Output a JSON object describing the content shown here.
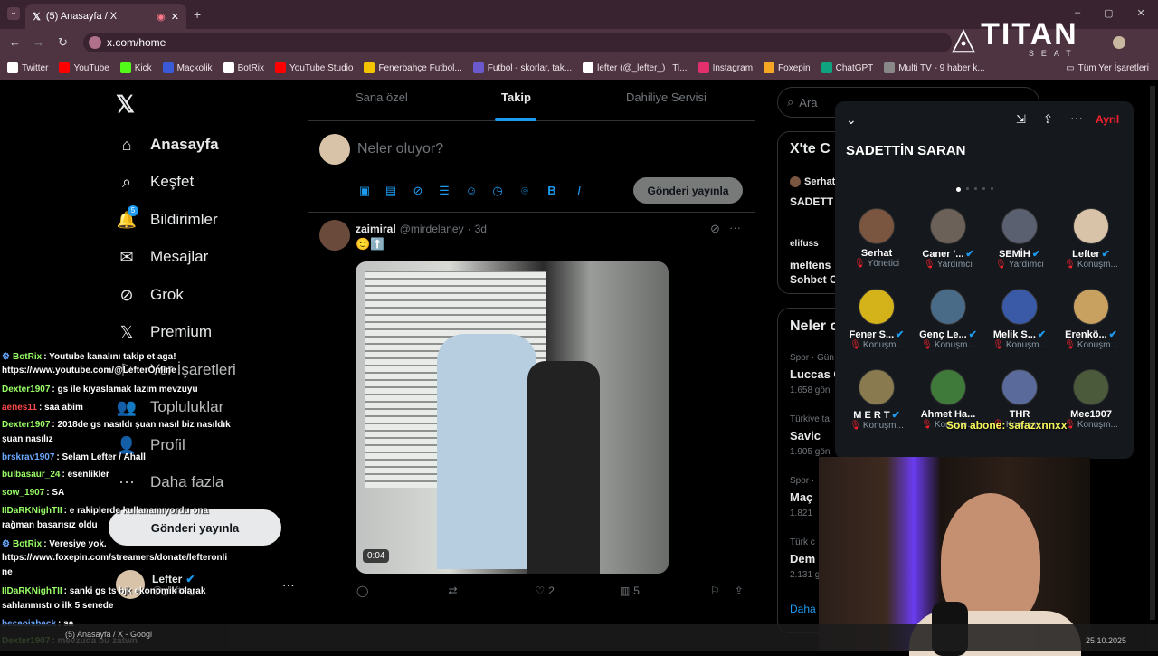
{
  "browser": {
    "tab_title": "(5) Anasayfa / X",
    "url": "x.com/home",
    "bookmarks": [
      "Twitter",
      "YouTube",
      "Kick",
      "Maçkolik",
      "BotRix",
      "YouTube Studio",
      "Fenerbahçe Futbol...",
      "Futbol - skorlar, tak...",
      "lefter (@_lefter_) | Ti...",
      "Instagram",
      "Foxepin",
      "ChatGPT",
      "Multi TV - 9 haber k..."
    ],
    "all_bookmarks": "Tüm Yer İşaretleri"
  },
  "overlay": {
    "brand": "TITAN",
    "brand_sub": "SEAT",
    "last_sub": "Son abone: safazxnnxx"
  },
  "sidebar": {
    "items": [
      "Anasayfa",
      "Keşfet",
      "Bildirimler",
      "Mesajlar",
      "Grok",
      "Premium",
      "Yer İşaretleri",
      "Topluluklar",
      "Profil",
      "Daha fazla"
    ],
    "notif_count": "5",
    "post_button": "Gönderi yayınla",
    "user_name": "Lefter",
    "user_handle": "@_lefter_"
  },
  "feed": {
    "tabs": [
      "Sana özel",
      "Takip",
      "Dahiliye Servisi"
    ],
    "compose_placeholder": "Neler oluyor?",
    "post_button": "Gönderi yayınla",
    "post": {
      "name": "zaimiral",
      "handle": "@mirdelaney",
      "time": "3d",
      "text": "🙂⬆️",
      "duration": "0:04",
      "likes": "2",
      "views": "5"
    }
  },
  "right": {
    "search": "Ara",
    "trends_title": "X'te C",
    "trend_user": "Serhat",
    "trend_text": "SADETT",
    "item2": "elifuss",
    "item2b": "meltens",
    "item2c": "Sohbet C",
    "happen_title": "Neler o",
    "trends": [
      {
        "cat": "Spor · Gün",
        "name": "Luccas C",
        "count": "1.658 gön"
      },
      {
        "cat": "Türkiye ta",
        "name": "Savic",
        "count": "1.905 gön"
      },
      {
        "cat": "Spor ·",
        "name": "Maç",
        "count": "1.821"
      },
      {
        "cat": "Türk c",
        "name": "Dem",
        "count": "2.131 g"
      }
    ],
    "more": "Daha"
  },
  "spaces": {
    "title": "SADETTİN SARAN",
    "leave": "Ayrıl",
    "people": [
      {
        "name": "Serhat",
        "role": "Yönetici",
        "verified": false,
        "color": "#7a5540"
      },
      {
        "name": "Caner '...",
        "role": "Yardımcı",
        "verified": true,
        "color": "#6b6158"
      },
      {
        "name": "SEMİH",
        "role": "Yardımcı",
        "verified": true,
        "color": "#5a6070"
      },
      {
        "name": "Lefter",
        "role": "Konuşm...",
        "verified": true,
        "color": "#d8c2a8"
      },
      {
        "name": "Fener S...",
        "role": "Konuşm...",
        "verified": true,
        "color": "#d4b21a"
      },
      {
        "name": "Genç Le...",
        "role": "Konuşm...",
        "verified": true,
        "color": "#4a6b88"
      },
      {
        "name": "Melik S...",
        "role": "Konuşm...",
        "verified": true,
        "color": "#3a5aa8"
      },
      {
        "name": "Erenkö...",
        "role": "Konuşm...",
        "verified": true,
        "color": "#c8a060"
      },
      {
        "name": "M E R T",
        "role": "Konuşm...",
        "verified": true,
        "color": "#8a7a50"
      },
      {
        "name": "Ahmet Ha...",
        "role": "Konuşm...",
        "verified": false,
        "color": "#3f7a3a"
      },
      {
        "name": "THR",
        "role": "Konuşm...",
        "verified": false,
        "color": "#5a6a9a"
      },
      {
        "name": "Mec1907",
        "role": "Konuşm...",
        "verified": false,
        "color": "#4a5a3a"
      }
    ]
  },
  "chat": [
    {
      "user": "BotRix",
      "ucolor": "#9aff66",
      "text": ": Youtube kanalını takip et aga!",
      "pre": "⚙"
    },
    {
      "user": "",
      "ucolor": "#fff",
      "text": "https://www.youtube.com/@LefterOnline",
      "pre": ""
    },
    {
      "user": "Dexter1907",
      "ucolor": "#9aff66",
      "text": ": gs ile kıyaslamak lazım mevzuyu",
      "pre": ""
    },
    {
      "user": "aenes11",
      "ucolor": "#ff4a4a",
      "text": ": saa abim",
      "pre": ""
    },
    {
      "user": "Dexter1907",
      "ucolor": "#9aff66",
      "text": ": 2018de gs nasıldı şuan nasıl biz nasıldık",
      "pre": ""
    },
    {
      "user": "",
      "ucolor": "#fff",
      "text": "şuan nasılız",
      "pre": ""
    },
    {
      "user": "brskrav1907",
      "ucolor": "#6aa8ff",
      "text": ": Selam Lefter / Ahall",
      "pre": ""
    },
    {
      "user": "bulbasaur_24",
      "ucolor": "#9aff66",
      "text": ": esenlikler",
      "pre": ""
    },
    {
      "user": "sow_1907",
      "ucolor": "#9aff66",
      "text": ": SA",
      "pre": ""
    },
    {
      "user": "IIDaRKNighTII",
      "ucolor": "#9aff66",
      "text": ": e rakiplerde kullanamıyordu ona",
      "pre": ""
    },
    {
      "user": "",
      "ucolor": "#fff",
      "text": "rağman basarısız oldu",
      "pre": ""
    },
    {
      "user": "BotRix",
      "ucolor": "#9aff66",
      "text": ": Veresiye yok.",
      "pre": "⚙"
    },
    {
      "user": "",
      "ucolor": "#fff",
      "text": "https://www.foxepin.com/streamers/donate/lefteronli",
      "pre": ""
    },
    {
      "user": "",
      "ucolor": "#fff",
      "text": "ne",
      "pre": ""
    },
    {
      "user": "IIDaRKNighTII",
      "ucolor": "#9aff66",
      "text": ": sanki gs ts bjk ekonomik olarak",
      "pre": ""
    },
    {
      "user": "",
      "ucolor": "#fff",
      "text": "sahlanmıstı o ilk 5 senede",
      "pre": ""
    },
    {
      "user": "becaoisback",
      "ucolor": "#6aa8ff",
      "text": ": sa",
      "pre": ""
    },
    {
      "user": "Dexter1907",
      "ucolor": "#9aff66",
      "text": ": mevzuda bu zatwn",
      "pre": ""
    }
  ],
  "taskbar": {
    "window": "(5) Anasayfa / X - Googl",
    "date": "25.10.2025"
  }
}
